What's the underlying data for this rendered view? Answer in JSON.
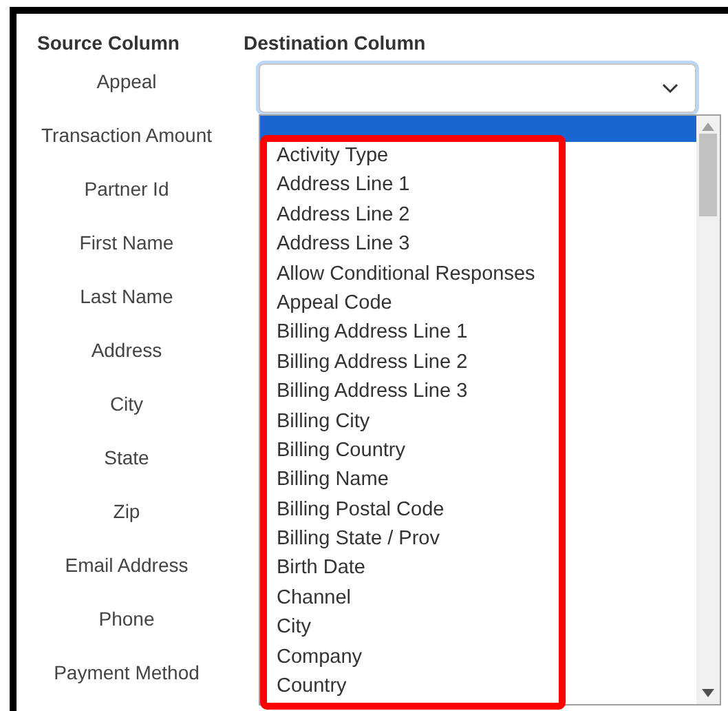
{
  "headers": {
    "source": "Source Column",
    "destination": "Destination Column"
  },
  "source_columns": [
    "Appeal",
    "Transaction Amount",
    "Partner Id",
    "First Name",
    "Last Name",
    "Address",
    "City",
    "State",
    "Zip",
    "Email Address",
    "Phone",
    "Payment Method"
  ],
  "destination_select": {
    "focused": true,
    "dropdown": {
      "open": true,
      "blank_option_selected": true,
      "highlight_box": true,
      "options": [
        {
          "label": "Activity Type",
          "selected": false
        },
        {
          "label": "Address Line 1",
          "selected": false
        },
        {
          "label": "Address Line 2",
          "selected": false
        },
        {
          "label": "Address Line 3",
          "selected": false
        },
        {
          "label": "Allow Conditional Responses",
          "selected": false
        },
        {
          "label": "Appeal Code",
          "selected": false
        },
        {
          "label": "Billing Address Line 1",
          "selected": false
        },
        {
          "label": "Billing Address Line 2",
          "selected": false
        },
        {
          "label": "Billing Address Line 3",
          "selected": false
        },
        {
          "label": "Billing City",
          "selected": false
        },
        {
          "label": "Billing Country",
          "selected": false
        },
        {
          "label": "Billing Name",
          "selected": false
        },
        {
          "label": "Billing Postal Code",
          "selected": false
        },
        {
          "label": "Billing State / Prov",
          "selected": false
        },
        {
          "label": "Birth Date",
          "selected": false
        },
        {
          "label": "Channel",
          "selected": false
        },
        {
          "label": "City",
          "selected": false
        },
        {
          "label": "Company",
          "selected": false
        },
        {
          "label": "Country",
          "selected": false
        }
      ]
    }
  }
}
